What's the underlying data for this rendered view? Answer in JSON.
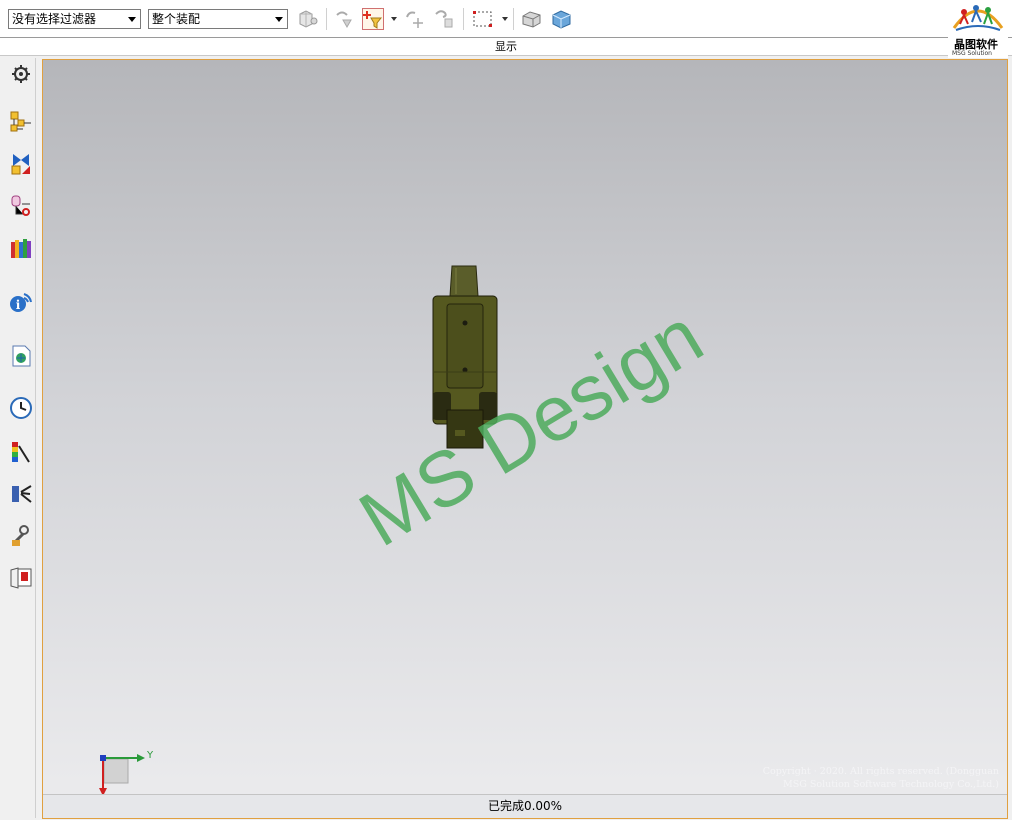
{
  "toolbar": {
    "selection_filter": {
      "value": "没有选择过滤器"
    },
    "scope": {
      "value": "整个装配"
    },
    "group_label": "显示",
    "icons": [
      "assembly-filter-icon",
      "snap-point-icon",
      "filter-select-icon",
      "rotate-pick-icon",
      "lasso-pick-icon",
      "rectangle-select-icon",
      "shaded-view-icon",
      "wireframe-box-icon"
    ]
  },
  "logo": {
    "name": "晶图软件",
    "subtitle": "MSG Solution"
  },
  "sidebar": {
    "items": [
      "settings-gear-icon",
      "assembly-navigator-icon",
      "constraint-navigator-icon",
      "part-navigator-icon",
      "reuse-library-icon",
      "info-feed-icon",
      "document-icon",
      "history-clock-icon",
      "color-palette-icon",
      "roles-icon",
      "process-studio-icon",
      "book-icon"
    ]
  },
  "viewport": {
    "watermark": "MS Design",
    "copyright_line1": "Copyright · 2020. All rights reserved. (Dongguan",
    "copyright_line2": "MSG Solution Software Technology Co.,Ltd.)",
    "axis_y_label": "Y"
  },
  "status": {
    "text": "已完成0.00%"
  },
  "colors": {
    "viewport_border": "#e0a040",
    "model": "#4c4f22",
    "watermark": "#4caa5c"
  }
}
